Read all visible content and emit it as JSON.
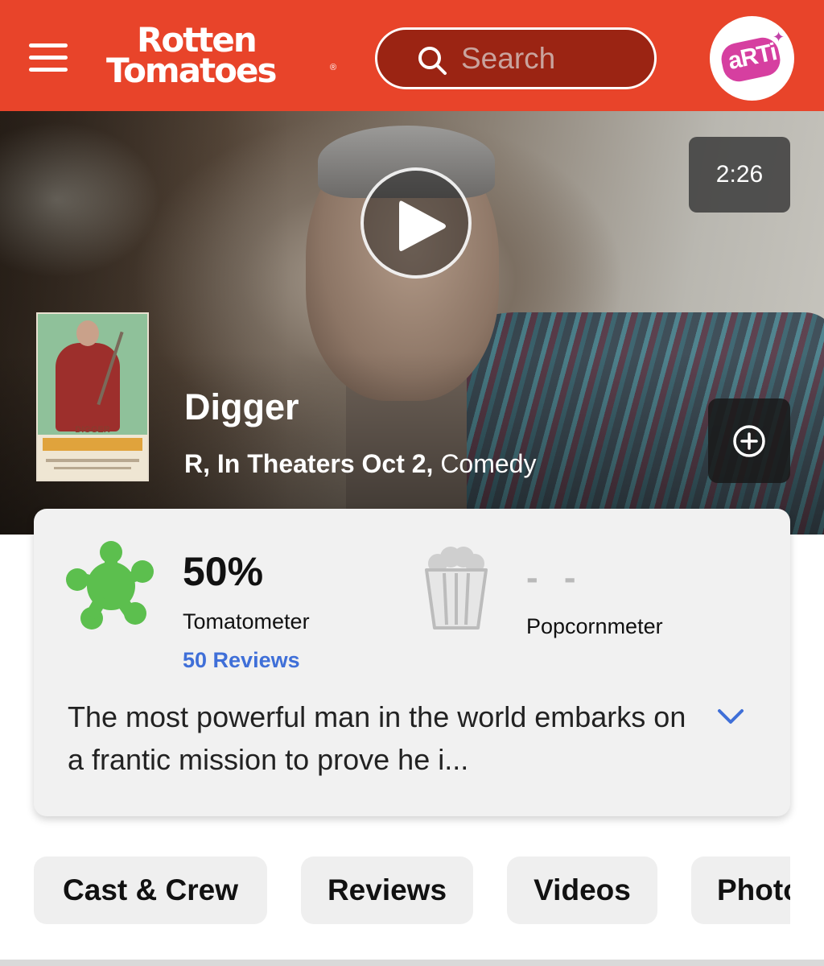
{
  "header": {
    "brand_line1": "Rotten",
    "brand_line2": "Tomatoes",
    "brand_reg": "®",
    "search_placeholder": "Search",
    "avatar_text": "aRTi",
    "brand_color": "#e8442a"
  },
  "hero": {
    "duration": "2:26",
    "title": "Digger",
    "rating_release": "R, In Theaters Oct 2,",
    "genre": "Comedy",
    "poster_title": "DIGGER"
  },
  "scores": {
    "tomatometer_score": "50%",
    "tomatometer_label": "Tomatometer",
    "reviews_link": "50 Reviews",
    "popcornmeter_score": "- -",
    "popcornmeter_label": "Popcornmeter",
    "splat_color": "#5cbf4e",
    "link_color": "#3f6fd8"
  },
  "synopsis": {
    "text": "The most powerful man in the world embarks on a frantic mission to prove he i..."
  },
  "tabs": [
    {
      "label": "Cast & Crew"
    },
    {
      "label": "Reviews"
    },
    {
      "label": "Videos"
    },
    {
      "label": "Photos"
    }
  ],
  "icons": [
    "menu-icon",
    "search-icon",
    "play-icon",
    "add-icon",
    "tomatometer-splat-icon",
    "popcorn-bucket-icon",
    "chevron-down-icon"
  ]
}
